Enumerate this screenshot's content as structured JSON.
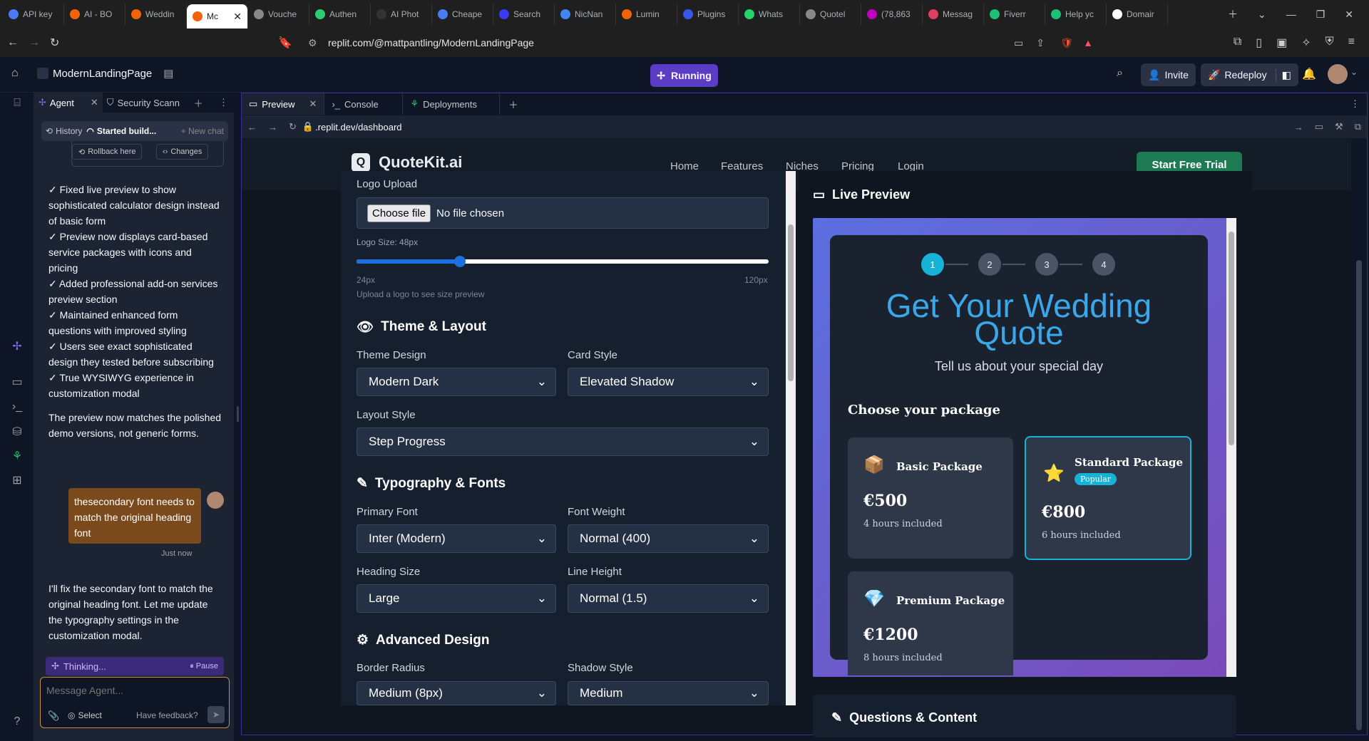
{
  "browser": {
    "tabs": [
      {
        "label": "API key",
        "color": "#4a7cf0"
      },
      {
        "label": "AI - BO",
        "color": "#f26207"
      },
      {
        "label": "Weddin",
        "color": "#f26207"
      },
      {
        "label": "Mc",
        "color": "#f26207",
        "active": true
      },
      {
        "label": "Vouche",
        "color": "#888888"
      },
      {
        "label": "Authen",
        "color": "#2ecc71"
      },
      {
        "label": "AI Phot",
        "color": "#333333"
      },
      {
        "label": "Cheape",
        "color": "#4a7cf0"
      },
      {
        "label": "Search",
        "color": "#3a3af0"
      },
      {
        "label": "NicNan",
        "color": "#4285f4"
      },
      {
        "label": "Lumin",
        "color": "#f26207"
      },
      {
        "label": "Plugins",
        "color": "#3858e9"
      },
      {
        "label": "Whats",
        "color": "#25d366"
      },
      {
        "label": "Quotel",
        "color": "#888888"
      },
      {
        "label": "(78,863",
        "color": "#c000c0"
      },
      {
        "label": "Messag",
        "color": "#e04060"
      },
      {
        "label": "Fiverr",
        "color": "#1dbf73"
      },
      {
        "label": "Help yc",
        "color": "#1dbf73"
      },
      {
        "label": "Domair",
        "color": "#ffffff"
      }
    ],
    "url": "replit.com/@mattpantling/ModernLandingPage"
  },
  "replit": {
    "project_name": "ModernLandingPage",
    "status": "Running",
    "invite": "Invite",
    "redeploy": "Redeploy",
    "agent_tabs": [
      "Agent",
      "Security Scann"
    ],
    "history": "History",
    "started": "Started build...",
    "new_chat": "+ New chat",
    "rollback": "Rollback here",
    "changes": "Changes",
    "messages": [
      "✓ Fixed live preview to show sophisticated calculator design instead of basic form",
      "✓ Preview now displays card-based service packages with icons and pricing",
      "✓ Added professional add-on services preview section",
      "✓ Maintained enhanced form questions with improved styling",
      "✓ Users see exact sophisticated design they tested before subscribing",
      "✓ True WYSIWYG experience in customization modal"
    ],
    "summary": "The preview now matches the polished demo versions, not generic forms.",
    "user_message": "thesecondary font needs to match the original heading font",
    "user_time": "Just now",
    "reply": "I'll fix the secondary font to match the original heading font. Let me update the typography settings in the customization modal.",
    "thinking": "Thinking...",
    "pause": "Pause",
    "composer_placeholder": "Message Agent...",
    "select": "Select",
    "feedback": "Have feedback?",
    "work_tabs": [
      "Preview",
      "Console",
      "Deployments"
    ],
    "preview_path": ".replit.dev/dashboard"
  },
  "site": {
    "logo": "QuoteKit.ai",
    "nav": [
      "Home",
      "Features",
      "Niches",
      "Pricing",
      "Login"
    ],
    "cta": "Start Free Trial"
  },
  "form": {
    "logo_upload_label": "Logo Upload",
    "choose_file": "Choose file",
    "no_file": "No file chosen",
    "logo_size_label": "Logo Size: 48px",
    "logo_size_value": 0.25,
    "min": "24px",
    "max": "120px",
    "logo_hint": "Upload a logo to see size preview",
    "theme_section": "Theme & Layout",
    "theme_design_label": "Theme Design",
    "theme_design": "Modern Dark",
    "card_style_label": "Card Style",
    "card_style": "Elevated Shadow",
    "layout_style_label": "Layout Style",
    "layout_style": "Step Progress",
    "typo_section": "Typography & Fonts",
    "primary_font_label": "Primary Font",
    "primary_font": "Inter (Modern)",
    "font_weight_label": "Font Weight",
    "font_weight": "Normal (400)",
    "heading_size_label": "Heading Size",
    "heading_size": "Large",
    "line_height_label": "Line Height",
    "line_height": "Normal (1.5)",
    "advanced_section": "Advanced Design",
    "border_radius_label": "Border Radius",
    "border_radius": "Medium (8px)",
    "shadow_style_label": "Shadow Style",
    "shadow_style": "Medium"
  },
  "live_preview": {
    "title": "Live Preview",
    "steps": [
      "1",
      "2",
      "3",
      "4"
    ],
    "heading": "Get Your Wedding Quote",
    "subheading": "Tell us about your special day",
    "choose": "Choose your package",
    "packages": [
      {
        "name": "Basic Package",
        "price": "€500",
        "detail": "4 hours included",
        "icon": "📦"
      },
      {
        "name": "Standard Package",
        "badge": "Popular",
        "price": "€800",
        "detail": "6 hours included",
        "icon": "⭐"
      },
      {
        "name": "Premium Package",
        "price": "€1200",
        "detail": "8 hours included",
        "icon": "💎"
      }
    ],
    "questions": "Questions & Content"
  },
  "colors": {
    "accent": "#5b3cc4",
    "step_active": "#17b3d6",
    "heading": "#3aa8e8"
  }
}
